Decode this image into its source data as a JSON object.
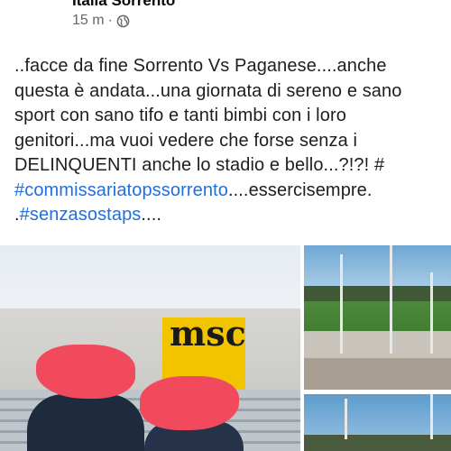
{
  "post": {
    "author": "Italia Sorrento",
    "time": "15 m",
    "separator": "·",
    "privacy_icon": "globe-icon",
    "text_line1": "..facce da fine Sorrento Vs Paganese....anche questa è andata...una giornata di sereno e sano sport con sano tifo e tanti bimbi con i loro genitori...ma vuoi vedere che forse senza i DELINQUENTI anche lo stadio e bello...?!?! #",
    "hashtag1": "#commissariatopssorrento",
    "text_mid": "....essercisempre.",
    "text_prefix2": ".",
    "hashtag2": "#senzasostaps",
    "text_end": "....",
    "colors": {
      "hashtag": "#216fdb",
      "meta": "#65676b",
      "redaction": "#f04a5c"
    }
  },
  "photos": {
    "left_logo_text": "msc"
  }
}
